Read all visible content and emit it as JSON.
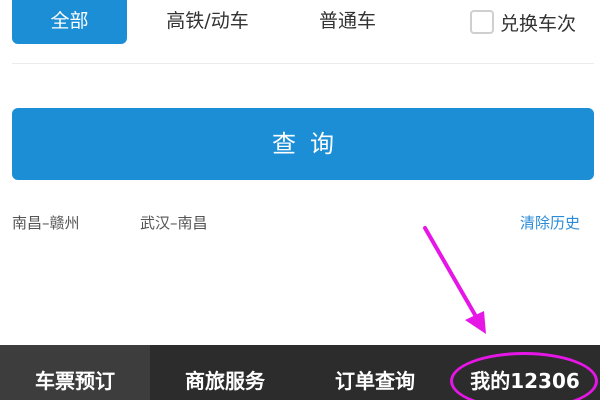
{
  "filters": {
    "tabs": [
      {
        "label": "全部",
        "active": true
      },
      {
        "label": "高铁/动车",
        "active": false
      },
      {
        "label": "普通车",
        "active": false
      }
    ],
    "exchange_label": "兑换车次",
    "exchange_checked": false
  },
  "query_button": {
    "label": "查询"
  },
  "history": {
    "items": [
      "南昌–赣州",
      "武汉–南昌"
    ],
    "clear_label": "清除历史"
  },
  "tabbar": {
    "items": [
      {
        "label": "车票预订",
        "active": true
      },
      {
        "label": "商旅服务",
        "active": false
      },
      {
        "label": "订单查询",
        "active": false
      },
      {
        "label": "我的12306",
        "active": false
      }
    ]
  },
  "colors": {
    "accent": "#1b8ed6",
    "tabbar_bg": "#2c2c2c",
    "annotation": "#e616e6",
    "link": "#2a8bd8"
  },
  "annotation": {
    "icon": "arrow-icon",
    "highlighted_item": "我的12306"
  }
}
